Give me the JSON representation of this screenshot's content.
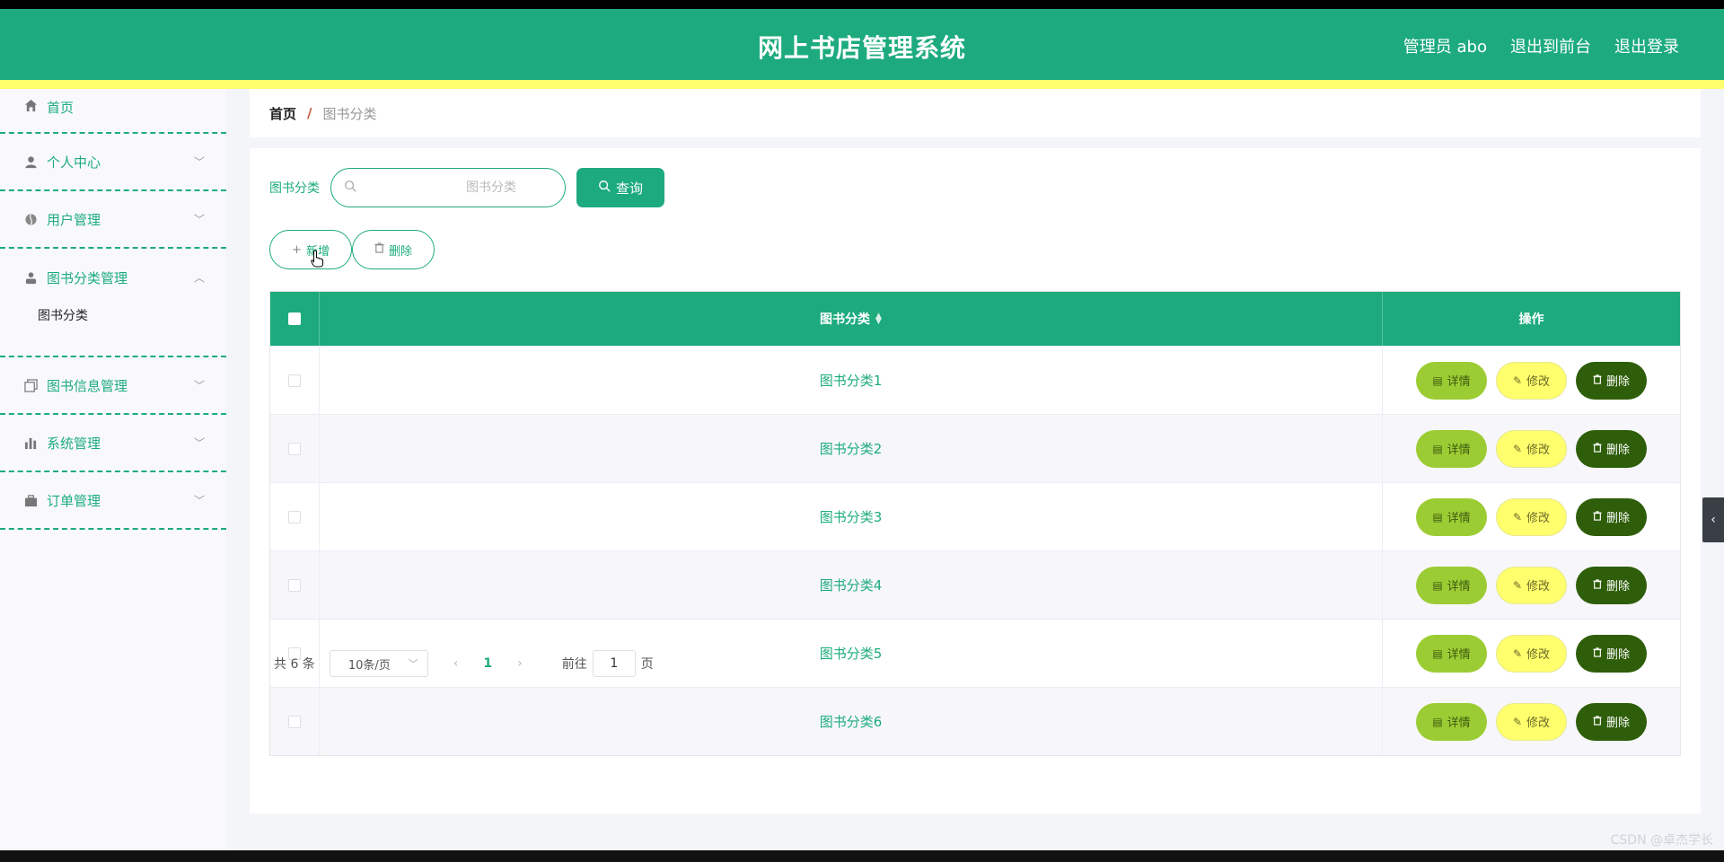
{
  "header": {
    "title": "网上书店管理系统",
    "links": [
      "管理员 abo",
      "退出到前台",
      "退出登录"
    ]
  },
  "sidebar": {
    "items": [
      {
        "label": "首页",
        "icon": "home-icon"
      },
      {
        "label": "个人中心",
        "icon": "user-icon"
      },
      {
        "label": "用户管理",
        "icon": "users-icon"
      },
      {
        "label": "图书分类管理",
        "icon": "person-icon",
        "open": true,
        "children": [
          "图书分类"
        ]
      },
      {
        "label": "图书信息管理",
        "icon": "copy-icon"
      },
      {
        "label": "系统管理",
        "icon": "bar-chart-icon"
      },
      {
        "label": "订单管理",
        "icon": "briefcase-icon"
      }
    ]
  },
  "breadcrumb": {
    "home": "首页",
    "separator": "/",
    "current": "图书分类"
  },
  "search": {
    "label": "图书分类",
    "placeholder": "图书分类",
    "value": "",
    "button": "查询"
  },
  "actions": {
    "add": "新增",
    "delete": "删除"
  },
  "table": {
    "columns": [
      "图书分类",
      "操作"
    ],
    "rows": [
      "图书分类1",
      "图书分类2",
      "图书分类3",
      "图书分类4",
      "图书分类5",
      "图书分类6"
    ],
    "row_actions": {
      "detail": "详情",
      "edit": "修改",
      "delete": "删除"
    }
  },
  "pagination": {
    "total": "共 6 条",
    "page_size": "10条/页",
    "current_page": "1",
    "goto_prefix": "前往",
    "goto_value": "1",
    "goto_suffix": "页"
  },
  "watermark": "CSDN @卓杰学长",
  "colors": {
    "primary": "#1dab7e",
    "stripe": "#fffe6c",
    "detail": "#9ccc33",
    "edit": "#fffe6c",
    "delete": "#2e5e09"
  }
}
